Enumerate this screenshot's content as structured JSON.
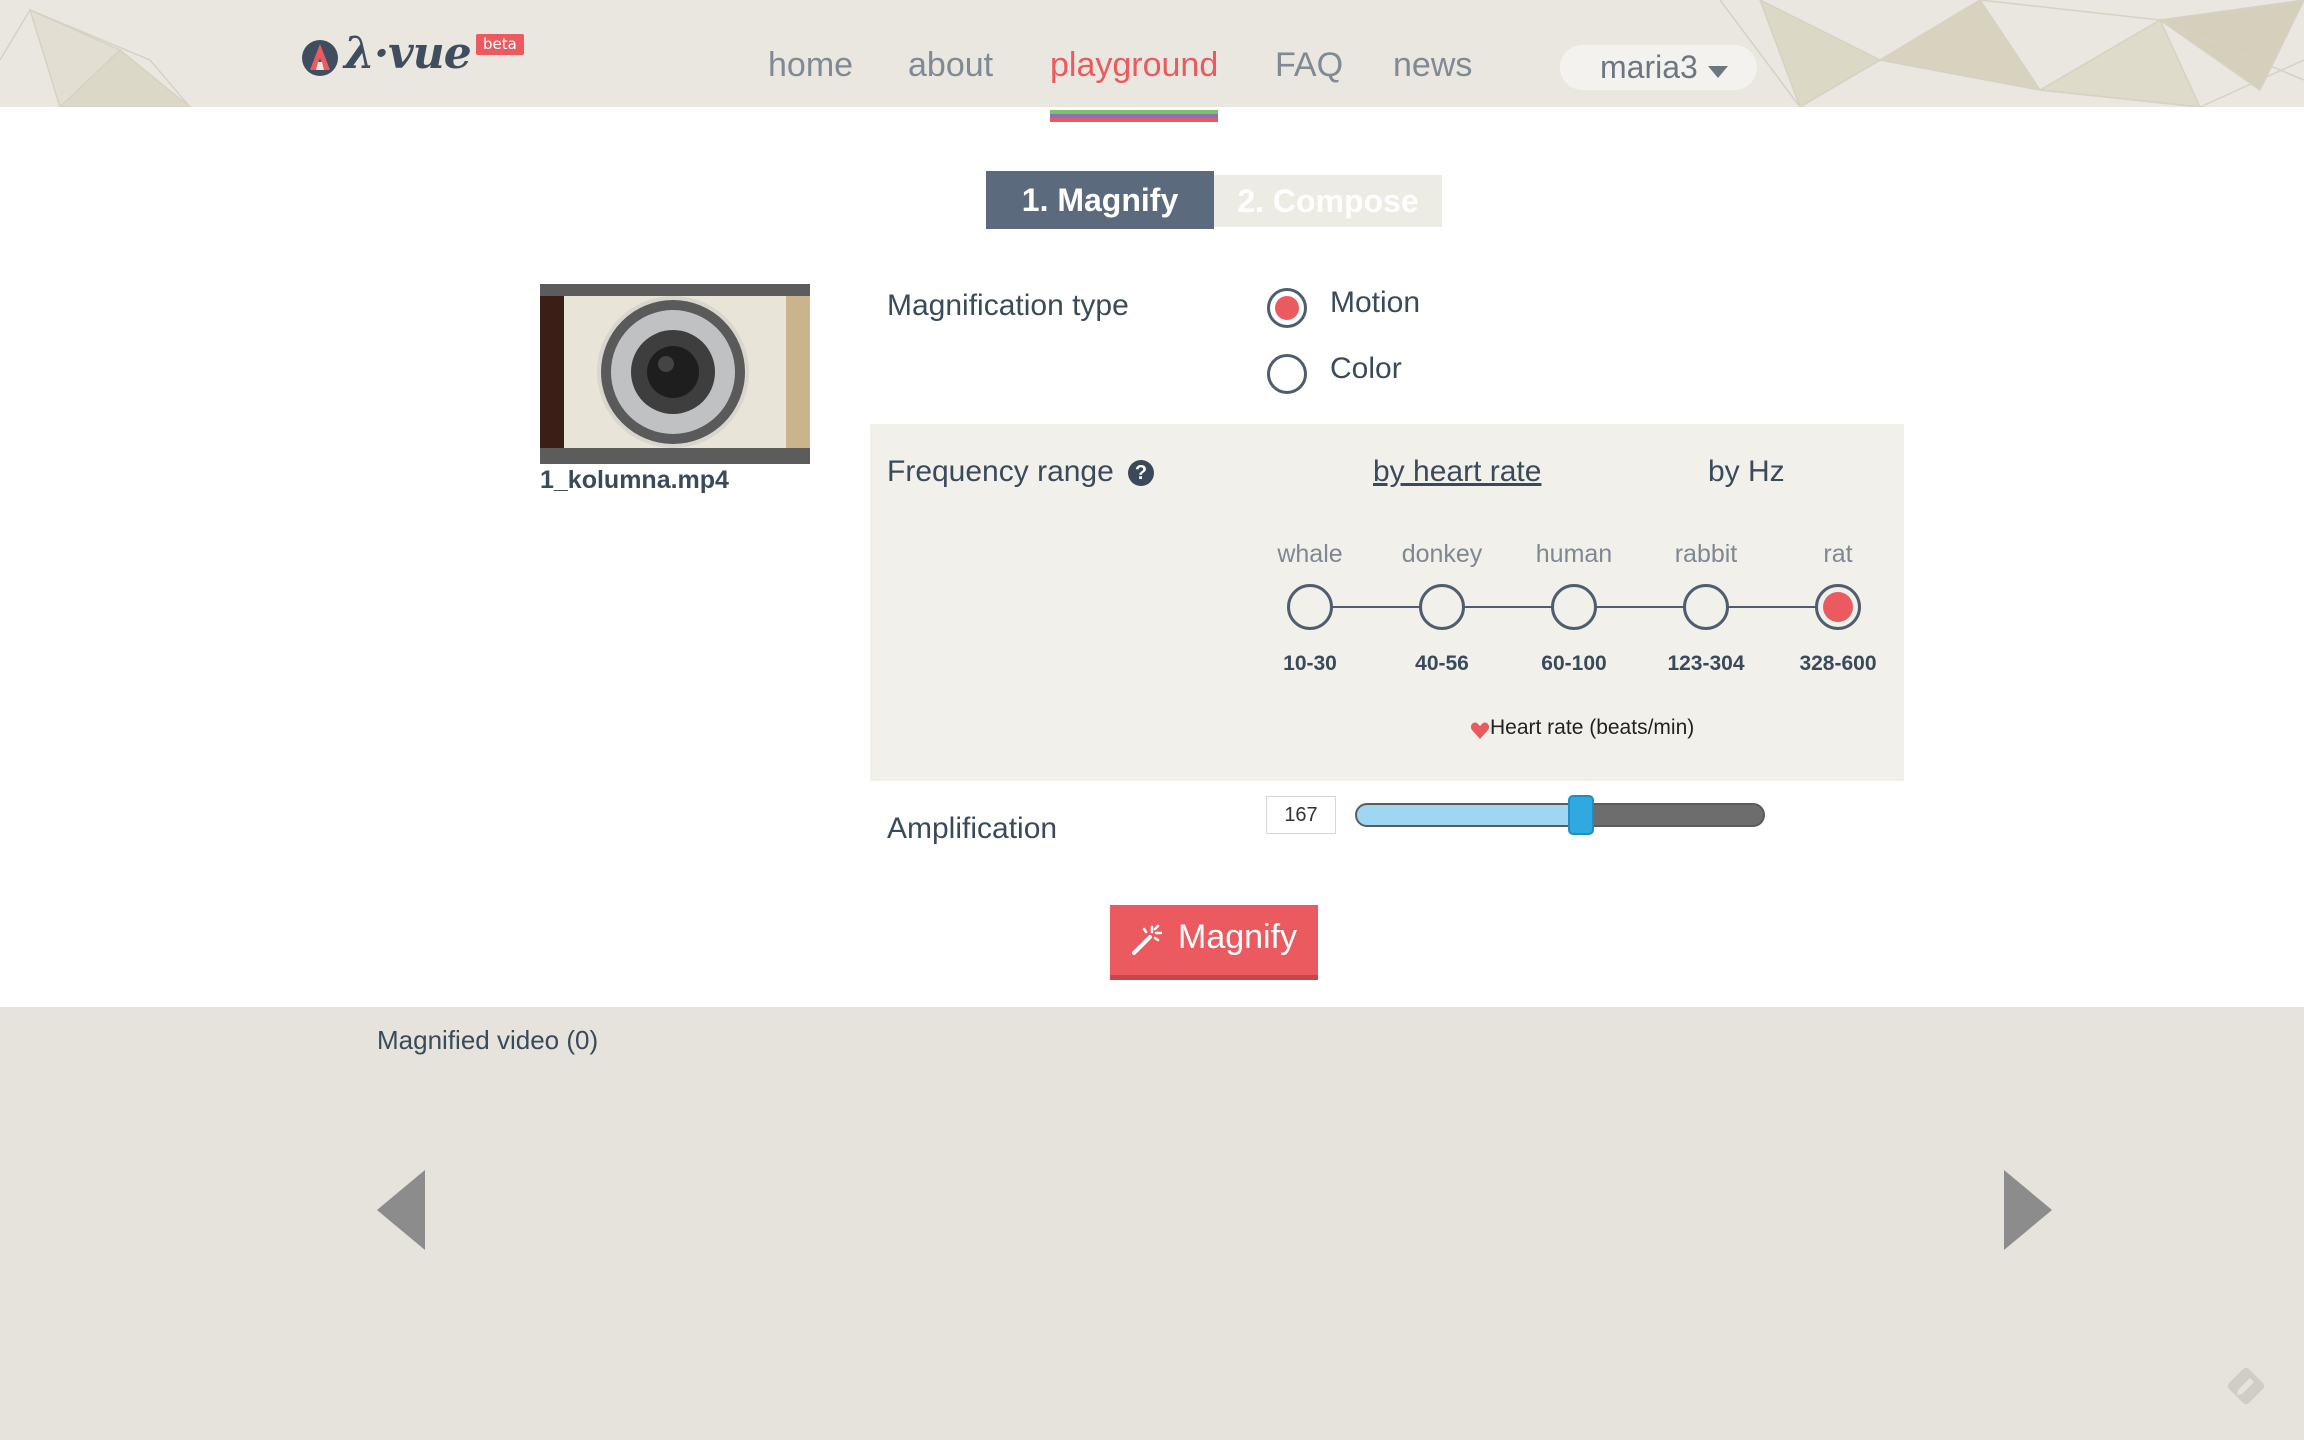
{
  "header": {
    "logo_text": "λ·vue",
    "logo_badge": "beta",
    "nav": [
      {
        "label": "home",
        "active": false
      },
      {
        "label": "about",
        "active": false
      },
      {
        "label": "playground",
        "active": true
      },
      {
        "label": "FAQ",
        "active": false
      },
      {
        "label": "news",
        "active": false
      }
    ],
    "user": "maria3"
  },
  "tabs": [
    {
      "label": "1. Magnify",
      "active": true
    },
    {
      "label": "2. Compose",
      "active": false
    }
  ],
  "video": {
    "filename": "1_kolumna.mp4"
  },
  "magnification": {
    "label": "Magnification type",
    "options": [
      {
        "label": "Motion",
        "checked": true
      },
      {
        "label": "Color",
        "checked": false
      }
    ]
  },
  "frequency": {
    "label": "Frequency range",
    "help_icon": "?",
    "modes": [
      {
        "label": "by heart rate",
        "selected": true
      },
      {
        "label": "by Hz",
        "selected": false
      }
    ],
    "animals": [
      {
        "name": "whale",
        "range": "10-30",
        "checked": false
      },
      {
        "name": "donkey",
        "range": "40-56",
        "checked": false
      },
      {
        "name": "human",
        "range": "60-100",
        "checked": false
      },
      {
        "name": "rabbit",
        "range": "123-304",
        "checked": false
      },
      {
        "name": "rat",
        "range": "328-600",
        "checked": true
      }
    ],
    "legend": "Heart rate (beats/min)"
  },
  "amplification": {
    "label": "Amplification",
    "value": "167",
    "slider_fraction": 0.55
  },
  "magnify_button": "Magnify",
  "results": {
    "title": "Magnified video (0)"
  },
  "colors": {
    "accent": "#ea5a5e",
    "slate": "#5b6a7c",
    "slider_thumb": "#30a8e0"
  }
}
